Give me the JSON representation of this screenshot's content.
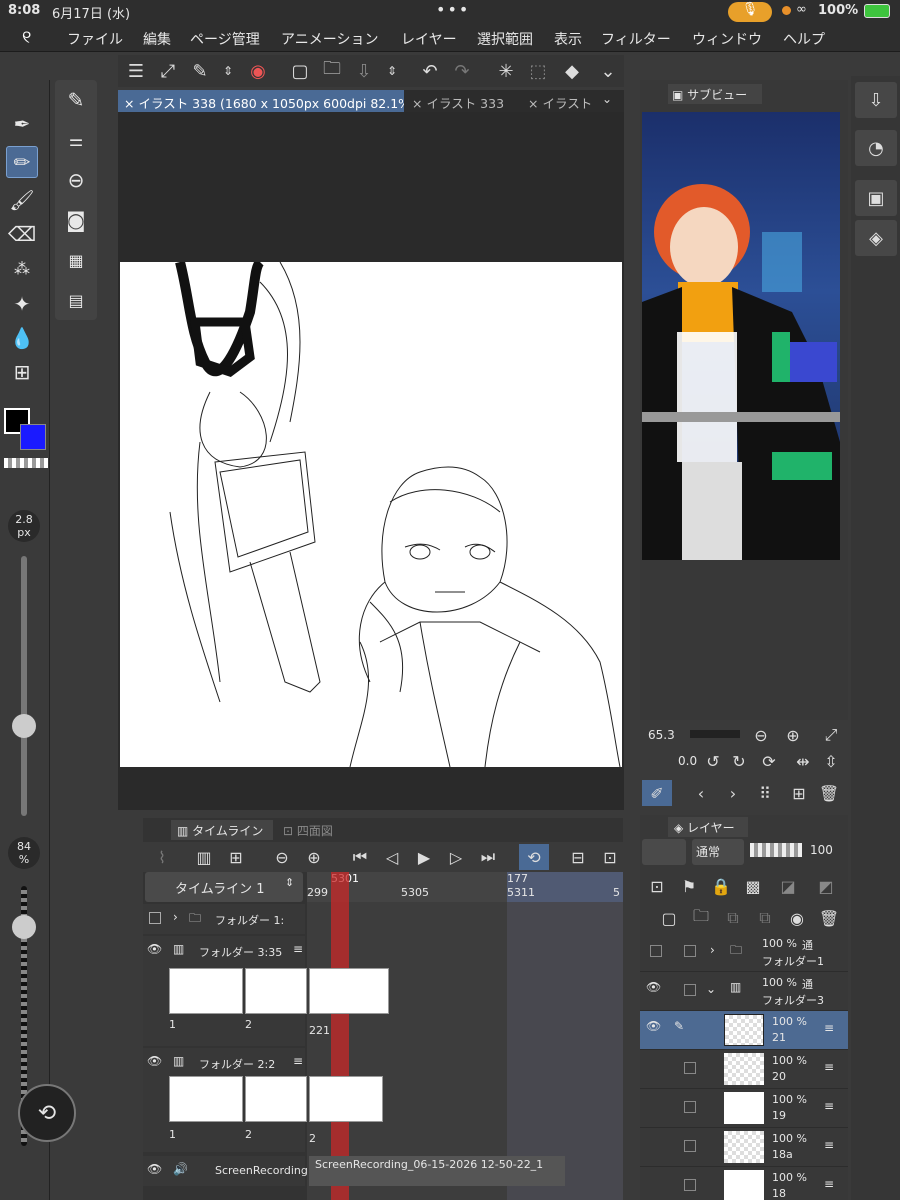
{
  "status": {
    "time": "8:08",
    "date": "6月17日 (水)",
    "battery": "100%"
  },
  "menu": [
    "ファイル",
    "編集",
    "ページ管理",
    "アニメーション",
    "レイヤー",
    "選択範囲",
    "表示",
    "フィルター",
    "ウィンドウ",
    "ヘルプ"
  ],
  "doc_tabs": [
    "イラスト 338 (1680 x 1050px 600dpi 82.1%)",
    "イラスト 333",
    "イラスト"
  ],
  "left_tools": {
    "brush_size": "2.8",
    "brush_unit": "px",
    "opacity": "84",
    "opacity_unit": "%"
  },
  "subview": {
    "tab": "サブビュー",
    "zoom": "65.3",
    "rotation": "0.0"
  },
  "timeline": {
    "tab": "タイムライン",
    "tab2": "四面図",
    "name": "タイムライン 1",
    "frame_current": "5301",
    "frame_177": "177",
    "ruler": [
      "299",
      "5305",
      "5311",
      "5"
    ],
    "tracks": [
      {
        "name": "フォルダー 1:",
        "frames": []
      },
      {
        "name": "フォルダー 3:35",
        "frames": [
          "1",
          "2",
          "221"
        ]
      },
      {
        "name": "フォルダー 2:2",
        "frames": [
          "1",
          "2",
          "2"
        ]
      },
      {
        "name": "ScreenRecording",
        "clip": "ScreenRecording_06-15-2026 12-50-22_1"
      }
    ]
  },
  "layers": {
    "tab": "レイヤー",
    "blend": "通常",
    "opacity": "100",
    "items": [
      {
        "pct": "100 %",
        "mode": "通",
        "name": "フォルダー1"
      },
      {
        "pct": "100 %",
        "mode": "通",
        "name": "フォルダー3"
      },
      {
        "pct": "100 %",
        "name": "21"
      },
      {
        "pct": "100 %",
        "name": "20"
      },
      {
        "pct": "100 %",
        "name": "19"
      },
      {
        "pct": "100 %",
        "name": "18a"
      },
      {
        "pct": "100 %",
        "name": "18"
      }
    ]
  },
  "colors": {
    "main": "#000000",
    "sub": "#1a1aff",
    "accent": "#5a7fb0",
    "playhead": "#c33"
  }
}
